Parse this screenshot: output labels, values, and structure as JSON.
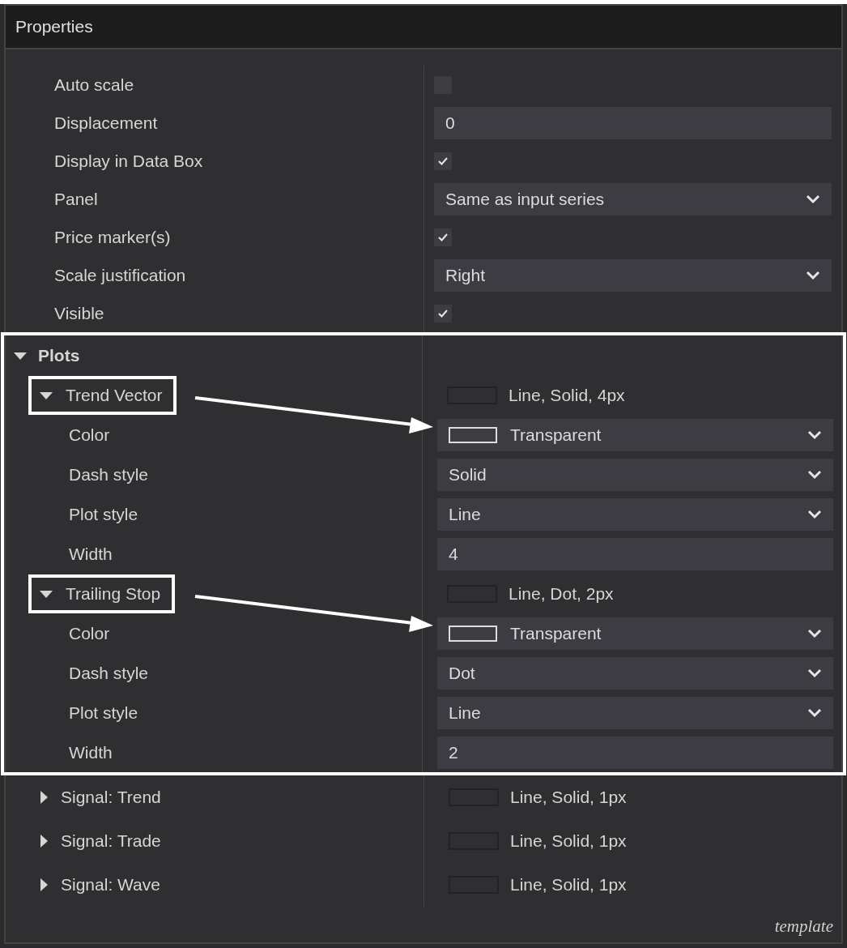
{
  "window": {
    "title": "Properties"
  },
  "properties": [
    {
      "label": "Auto scale",
      "kind": "checkbox",
      "checked": false
    },
    {
      "label": "Displacement",
      "kind": "text",
      "value": "0"
    },
    {
      "label": "Display in Data Box",
      "kind": "checkbox",
      "checked": true
    },
    {
      "label": "Panel",
      "kind": "dropdown",
      "value": "Same as input series"
    },
    {
      "label": "Price marker(s)",
      "kind": "checkbox",
      "checked": true
    },
    {
      "label": "Scale justification",
      "kind": "dropdown",
      "value": "Right"
    },
    {
      "label": "Visible",
      "kind": "checkbox",
      "checked": true
    }
  ],
  "plots_section": {
    "label": "Plots",
    "expanded": true,
    "highlighted": true,
    "highlighted_plots": [
      {
        "label": "Trend Vector",
        "expanded": true,
        "highlighted": true,
        "summary": "Line, Solid, 4px",
        "children": [
          {
            "label": "Color",
            "kind": "color",
            "value": "Transparent"
          },
          {
            "label": "Dash style",
            "kind": "dropdown",
            "value": "Solid"
          },
          {
            "label": "Plot style",
            "kind": "dropdown",
            "value": "Line"
          },
          {
            "label": "Width",
            "kind": "text",
            "value": "4"
          }
        ]
      },
      {
        "label": "Trailing Stop",
        "expanded": true,
        "highlighted": true,
        "summary": "Line, Dot, 2px",
        "children": [
          {
            "label": "Color",
            "kind": "color",
            "value": "Transparent"
          },
          {
            "label": "Dash style",
            "kind": "dropdown",
            "value": "Dot"
          },
          {
            "label": "Plot style",
            "kind": "dropdown",
            "value": "Line"
          },
          {
            "label": "Width",
            "kind": "text",
            "value": "2"
          }
        ]
      }
    ],
    "other_plots": [
      {
        "label": "Signal: Trend",
        "expanded": false,
        "summary": "Line, Solid, 1px"
      },
      {
        "label": "Signal: Trade",
        "expanded": false,
        "summary": "Line, Solid, 1px"
      },
      {
        "label": "Signal: Wave",
        "expanded": false,
        "summary": "Line, Solid, 1px"
      }
    ]
  },
  "footer": {
    "link": "template"
  }
}
